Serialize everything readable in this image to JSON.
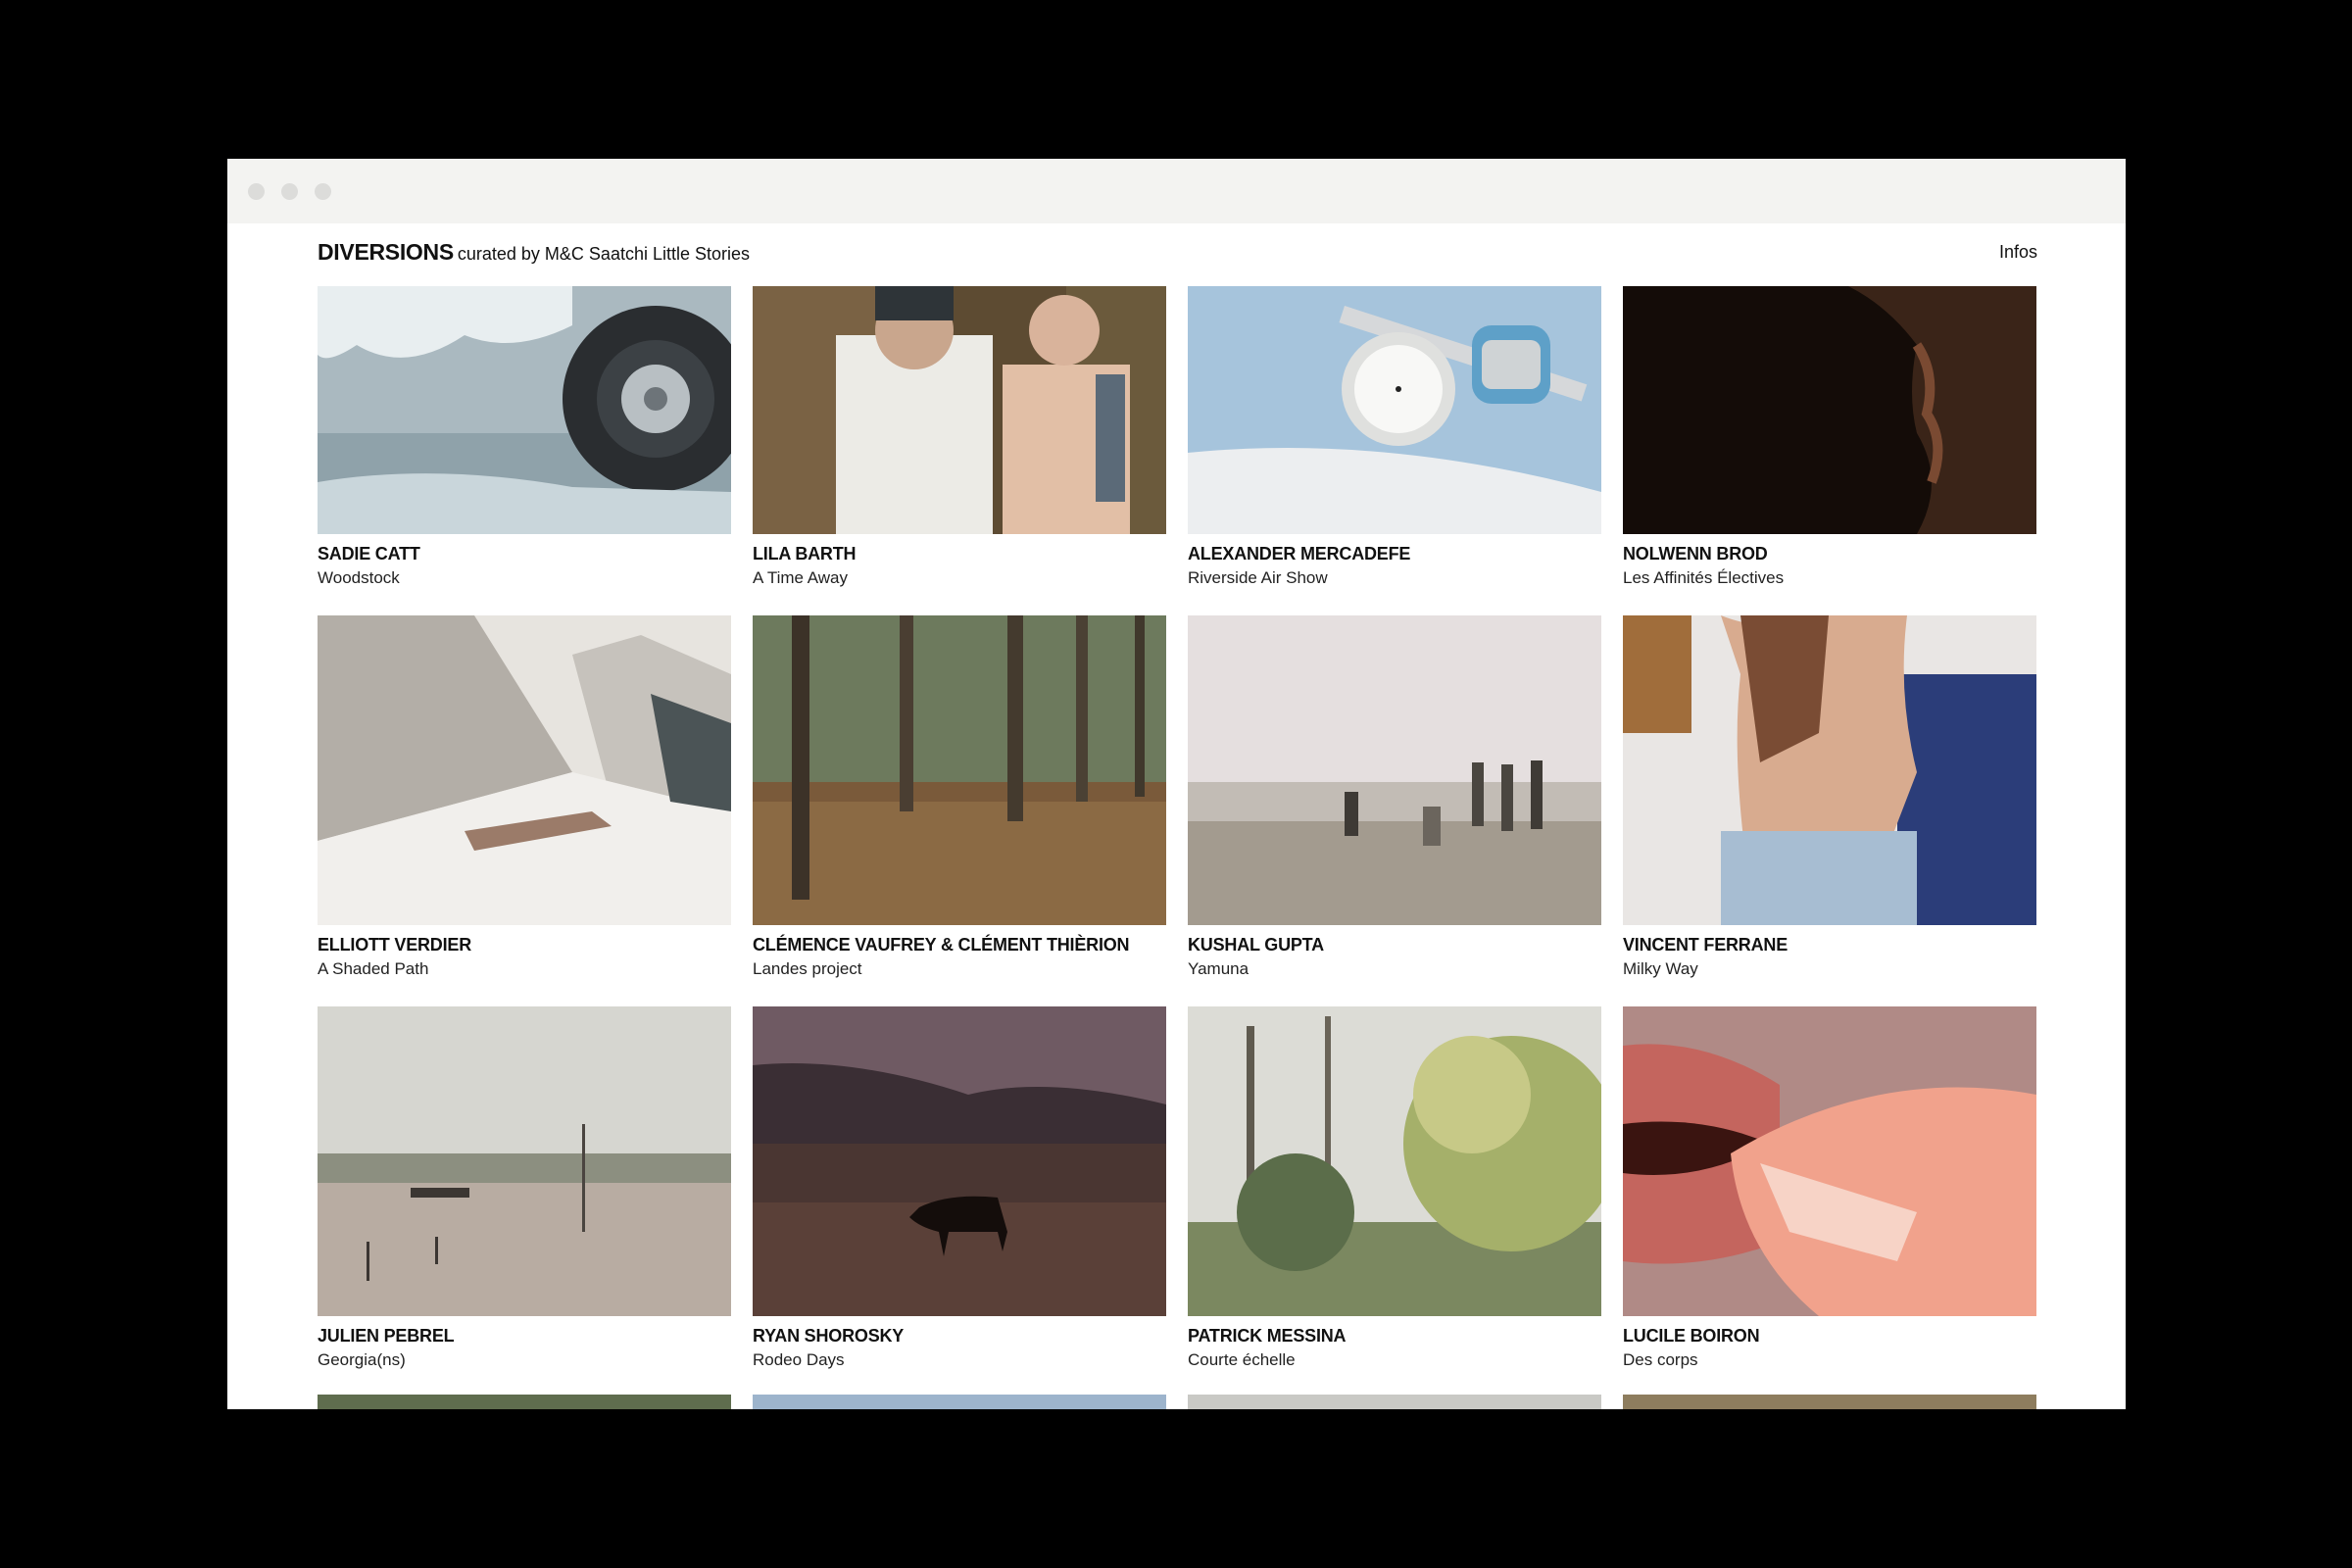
{
  "site": {
    "title": "DIVERSIONS",
    "tagline": "curated by M&C Saatchi Little Stories",
    "infos_link": "Infos"
  },
  "projects": [
    {
      "artist": "SADIE CATT",
      "title": "Woodstock"
    },
    {
      "artist": "LILA BARTH",
      "title": "A Time Away"
    },
    {
      "artist": "ALEXANDER MERCADEFE",
      "title": "Riverside Air Show"
    },
    {
      "artist": "NOLWENN BROD",
      "title": "Les Affinités Électives"
    },
    {
      "artist": "ELLIOTT VERDIER",
      "title": "A Shaded Path"
    },
    {
      "artist": "CLÉMENCE VAUFREY & CLÉMENT THIÈRION",
      "title": "Landes project"
    },
    {
      "artist": "KUSHAL GUPTA",
      "title": "Yamuna"
    },
    {
      "artist": "VINCENT FERRANE",
      "title": "Milky Way"
    },
    {
      "artist": "JULIEN PEBREL",
      "title": "Georgia(ns)"
    },
    {
      "artist": "RYAN SHOROSKY",
      "title": "Rodeo Days"
    },
    {
      "artist": "PATRICK MESSINA",
      "title": "Courte échelle"
    },
    {
      "artist": "LUCILE BOIRON",
      "title": "Des corps"
    }
  ],
  "colors": {
    "background": "#000000",
    "page": "#ffffff",
    "titlebar": "#f3f3f1",
    "text": "#111111"
  }
}
